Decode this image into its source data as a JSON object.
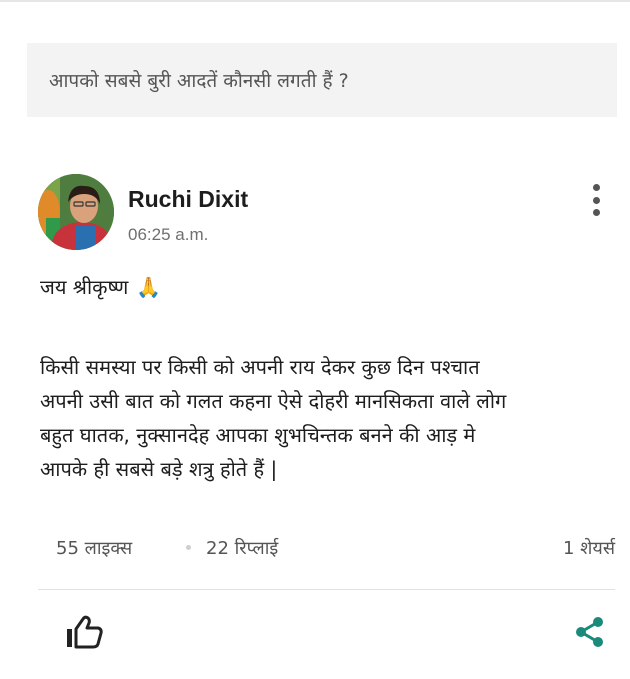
{
  "question": {
    "text": "आपको सबसे बुरी आदतें कौनसी लगती हैं ?"
  },
  "post": {
    "author": "Ruchi Dixit",
    "time": "06:25 a.m.",
    "greeting": "जय श्रीकृष्ण",
    "greeting_emoji": "🙏",
    "lines": [
      "किसी समस्या पर किसी को अपनी राय देकर कुछ दिन पश्चात",
      "अपनी उसी बात को गलत कहना ऐसे दोहरी मानसिकता वाले लोग",
      "बहुत घातक, नुक्सानदेह आपका शुभचिन्तक बनने की आड़ मे",
      "आपके ही सबसे बड़े शत्रु होते हैं |"
    ]
  },
  "stats": {
    "likes": "55 लाइक्स",
    "replies": "22 रिप्लाई",
    "shares": "1 शेयर्स"
  },
  "icons": {
    "more": "more-vertical-icon",
    "like": "thumbs-up-icon",
    "share": "share-icon"
  },
  "colors": {
    "share_accent": "#1a8a7a",
    "question_bg": "#f3f3f3"
  }
}
